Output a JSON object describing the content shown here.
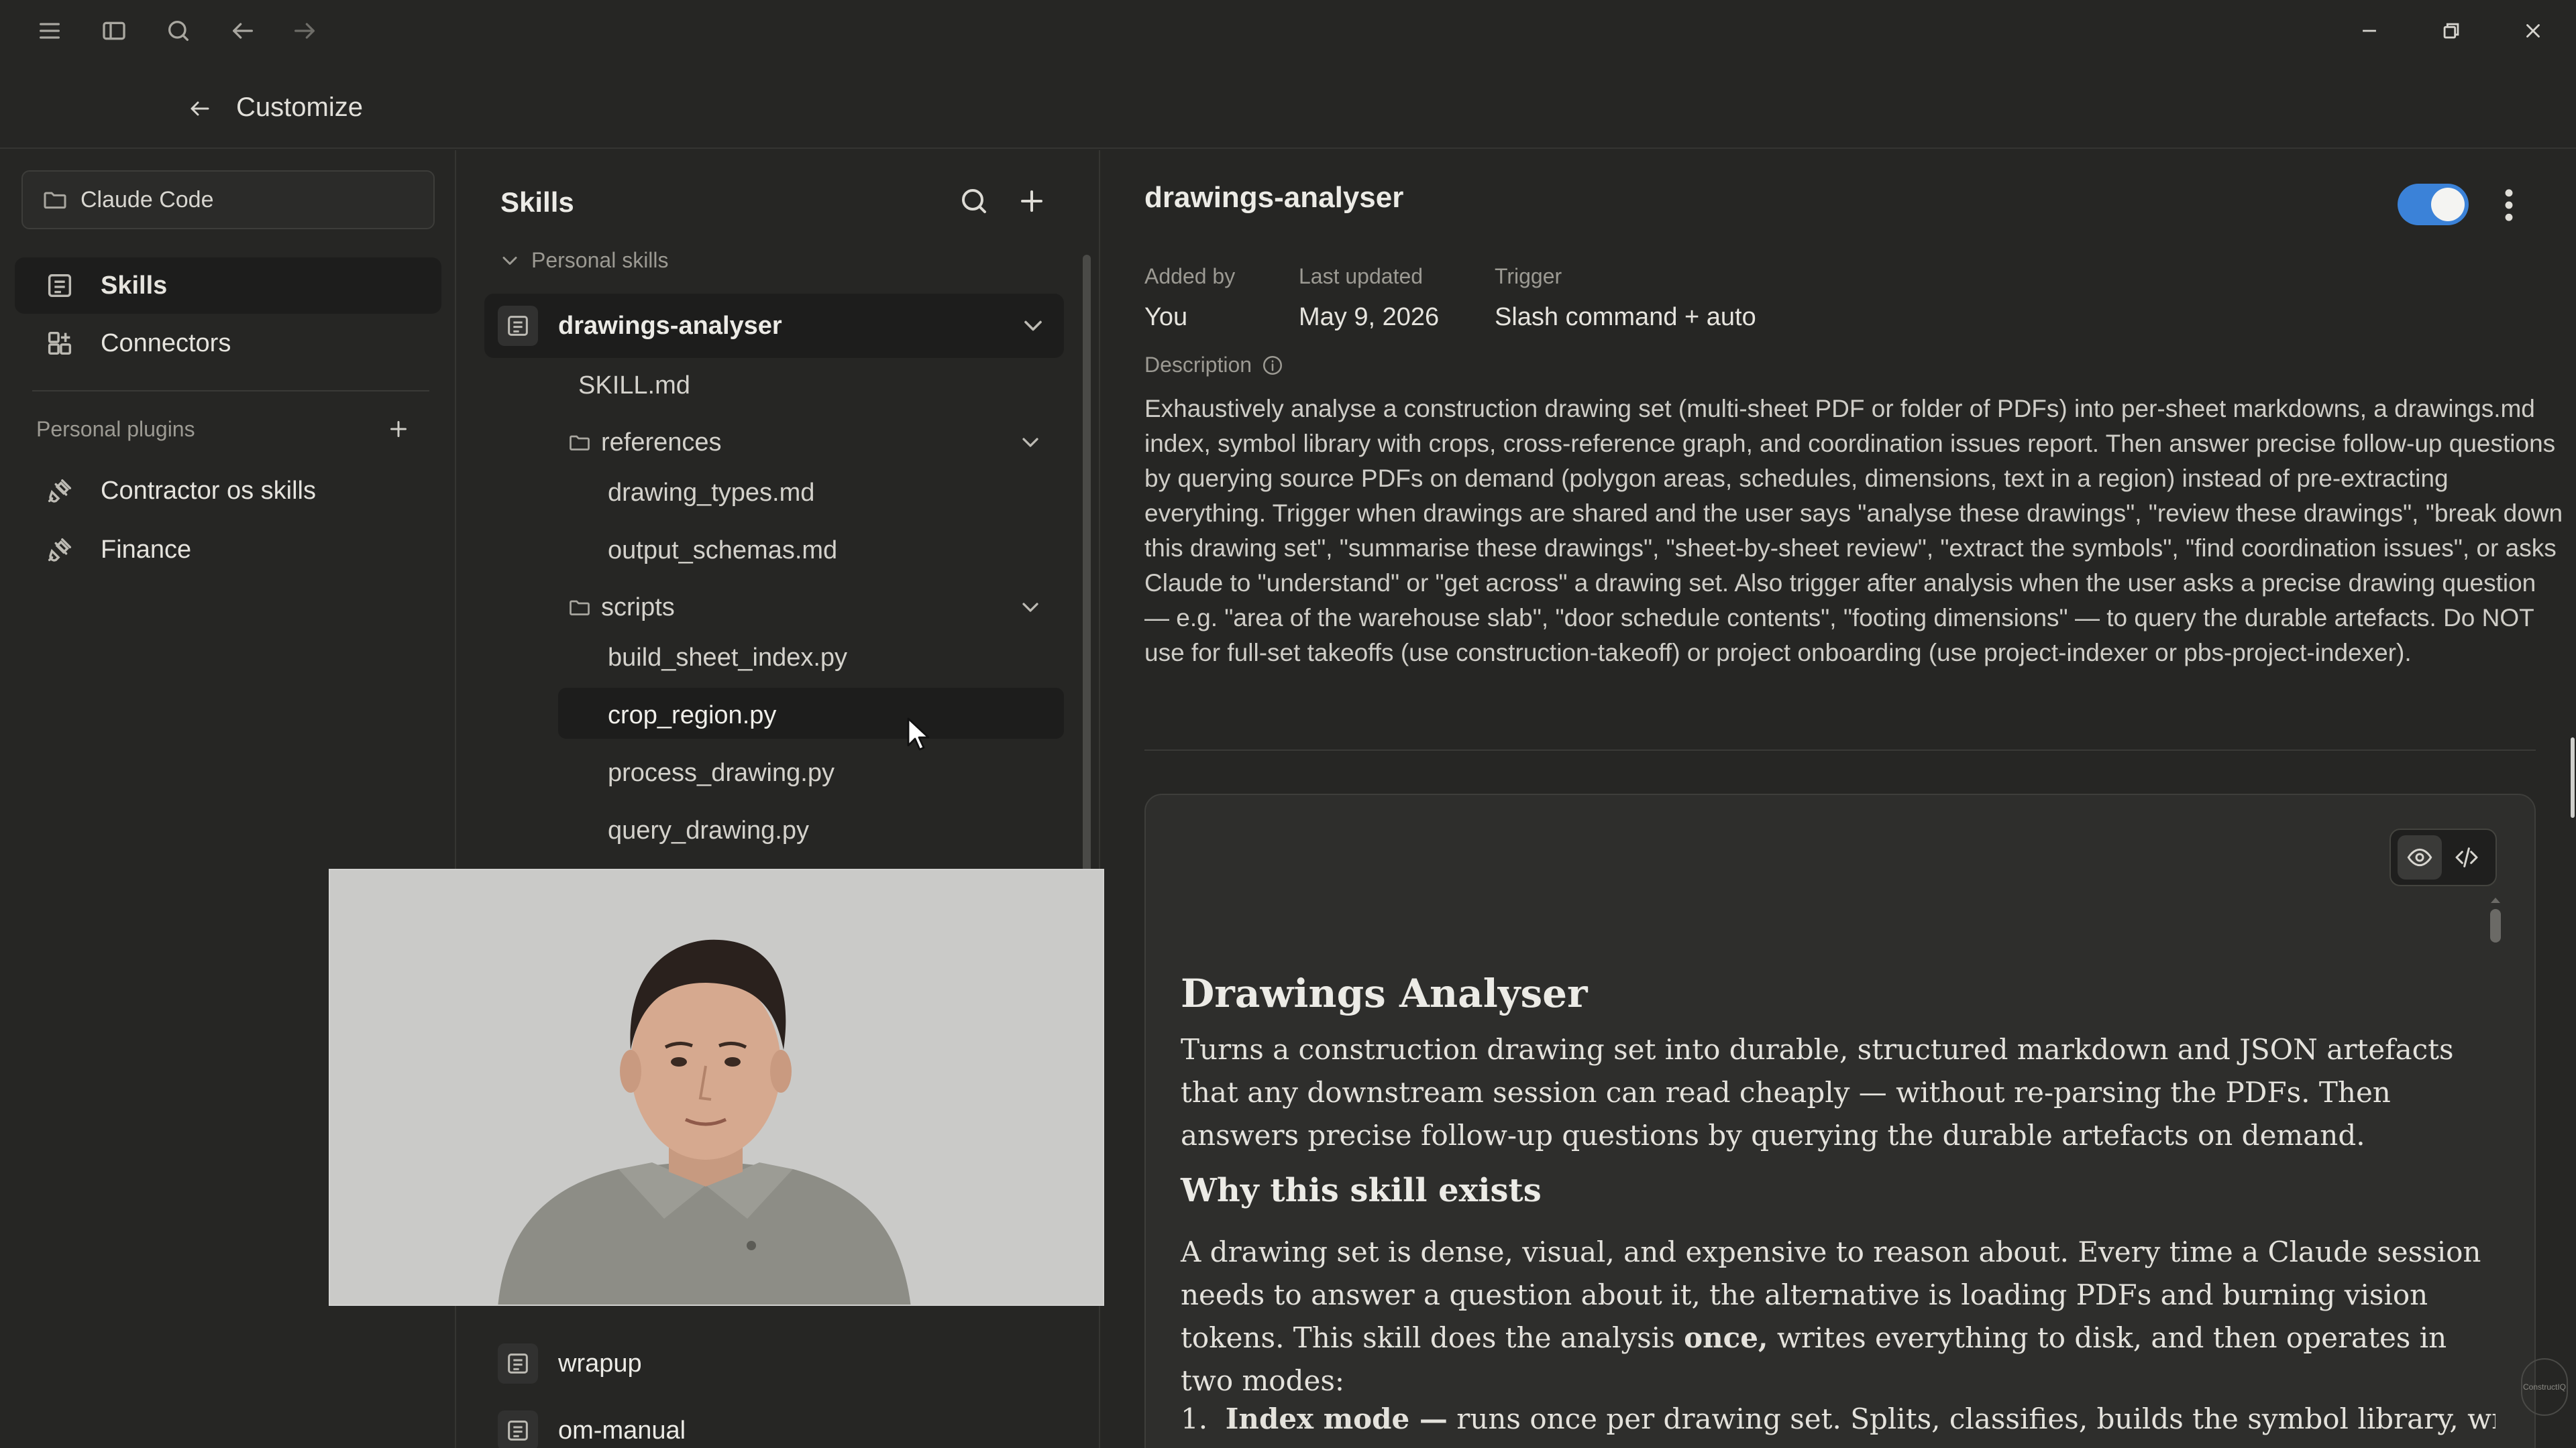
{
  "header": {
    "back_label": "Customize"
  },
  "workspace": {
    "selected": "Claude Code"
  },
  "nav": {
    "items": [
      {
        "label": "Skills",
        "icon": "skills-icon",
        "active": true
      },
      {
        "label": "Connectors",
        "icon": "connectors-icon",
        "active": false
      }
    ],
    "plugins_label": "Personal plugins",
    "plugins": [
      {
        "label": "Contractor os skills",
        "icon": "plug-icon"
      },
      {
        "label": "Finance",
        "icon": "plug-icon"
      }
    ]
  },
  "skills": {
    "title": "Skills",
    "group_label": "Personal skills",
    "selected_skill": "drawings-analyser",
    "files": {
      "skill_md": "SKILL.md",
      "references_folder": "references",
      "references": [
        "drawing_types.md",
        "output_schemas.md"
      ],
      "scripts_folder": "scripts",
      "scripts": [
        "build_sheet_index.py",
        "crop_region.py",
        "process_drawing.py",
        "query_drawing.py"
      ]
    },
    "other_skills": [
      "wrapup",
      "om-manual"
    ]
  },
  "detail": {
    "title": "drawings-analyser",
    "enabled": true,
    "meta": {
      "added_by_label": "Added by",
      "added_by": "You",
      "last_updated_label": "Last updated",
      "last_updated": "May 9, 2026",
      "trigger_label": "Trigger",
      "trigger": "Slash command + auto"
    },
    "description_label": "Description",
    "description": "Exhaustively analyse a construction drawing set (multi-sheet PDF or folder of PDFs) into per-sheet markdowns, a drawings.md index, symbol library with crops, cross-reference graph, and coordination issues report. Then answer precise follow-up questions by querying source PDFs on demand (polygon areas, schedules, dimensions, text in a region) instead of pre-extracting everything. Trigger when drawings are shared and the user says \"analyse these drawings\", \"review these drawings\", \"break down this drawing set\", \"summarise these drawings\", \"sheet-by-sheet review\", \"extract the symbols\", \"find coordination issues\", or asks Claude to \"understand\" or \"get across\" a drawing set. Also trigger after analysis when the user asks a precise drawing question — e.g. \"area of the warehouse slab\", \"door schedule contents\", \"footing dimensions\" — to query the durable artefacts. Do NOT use for full-set takeoffs (use construction-takeoff) or project onboarding (use project-indexer or pbs-project-indexer).",
    "doc": {
      "h1": "Drawings Analyser",
      "intro": "Turns a construction drawing set into durable, structured markdown and JSON artefacts that any downstream session can read cheaply — without re-parsing the PDFs. Then answers precise follow-up questions by querying the durable artefacts on demand.",
      "h2": "Why this skill exists",
      "p2_before": "A drawing set is dense, visual, and expensive to reason about. Every time a Claude session needs to answer a question about it, the alternative is loading PDFs and burning vision tokens. This skill does the analysis ",
      "p2_bold": "once,",
      "p2_after": " writes everything to disk, and then operates in two modes:",
      "li1_num": "1.",
      "li1_bold": "Index mode —",
      "li1_text": " runs once per drawing set. Splits, classifies, builds the symbol library, writes"
    }
  },
  "watermark": "ConstructIQ",
  "colors": {
    "background": "#262624",
    "toggle_on": "#3b82d8",
    "selected_row": "#1d1d1c"
  }
}
